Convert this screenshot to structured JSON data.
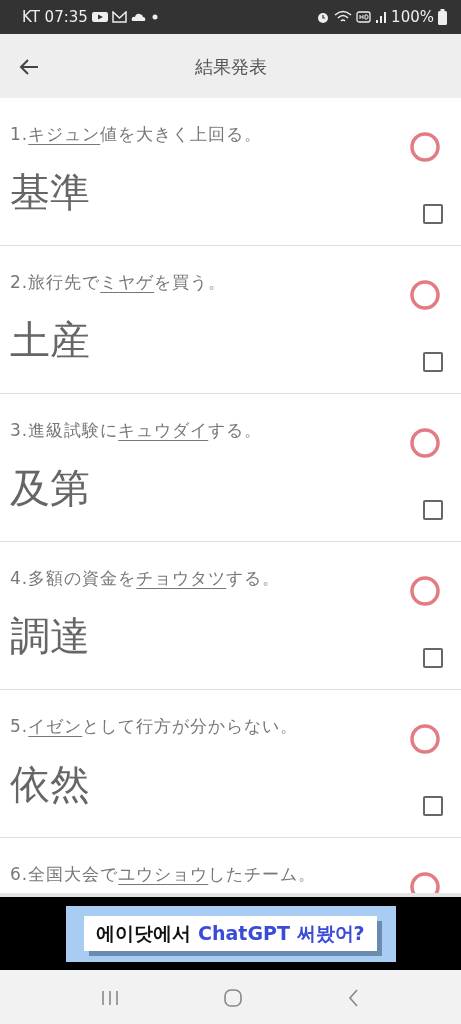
{
  "status_bar": {
    "carrier_time": "KT 07:35",
    "battery": "100%"
  },
  "header": {
    "title": "結果発表"
  },
  "items": [
    {
      "before": "1.",
      "target": "キジュン",
      "after": "値を大きく上回る。",
      "answer": "基準",
      "correct": true,
      "checked": false
    },
    {
      "before": "2.旅行先で",
      "target": "ミヤゲ",
      "after": "を買う。",
      "answer": "土産",
      "correct": true,
      "checked": false
    },
    {
      "before": "3.進級試験に",
      "target": "キュウダイ",
      "after": "する。",
      "answer": "及第",
      "correct": true,
      "checked": false
    },
    {
      "before": "4.多額の資金を",
      "target": "チョウタツ",
      "after": "する。",
      "answer": "調達",
      "correct": true,
      "checked": false
    },
    {
      "before": "5.",
      "target": "イゼン",
      "after": "として行方が分からない。",
      "answer": "依然",
      "correct": true,
      "checked": false
    },
    {
      "before": "6.全国大会で",
      "target": "ユウショウ",
      "after": "したチーム。",
      "correct": true
    }
  ],
  "ad": {
    "lead": "에이닷에서",
    "highlight": "ChatGPT 써봤어?"
  }
}
